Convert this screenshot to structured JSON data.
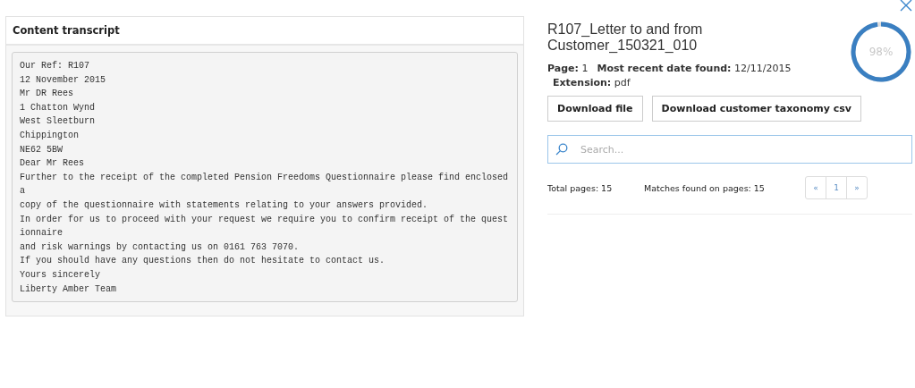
{
  "transcript": {
    "title": "Content transcript",
    "lines": [
      "Our Ref: R107",
      "12 November 2015",
      "Mr DR Rees",
      "1 Chatton Wynd",
      "West Sleetburn",
      "Chippington",
      "NE62 5BW",
      "Dear Mr Rees",
      "Further to the receipt of the completed Pension Freedoms Questionnaire please find enclosed",
      "a",
      "copy of the questionnaire with statements relating to your answers provided.",
      "In order for us to proceed with your request we require you to confirm receipt of the quest",
      "ionnaire",
      "and risk warnings by contacting us on 0161 763 7070.",
      "If you should have any questions then do not hesitate to contact us.",
      "Yours sincerely",
      "Liberty Amber Team"
    ]
  },
  "document": {
    "title": "R107_Letter to and from Customer_150321_010",
    "meta": [
      {
        "label": "Page:",
        "value": "1"
      },
      {
        "label": "Most recent date found:",
        "value": "12/11/2015"
      }
    ],
    "extension": {
      "label": "Extension:",
      "value": "pdf"
    },
    "gauge": {
      "reading": "98%"
    },
    "buttons": [
      "Download file",
      "Download customer taxonomy csv"
    ],
    "search": {
      "placeholder": "Search..."
    },
    "total_pages": "Total pages: 15",
    "matches": "Matches found on pages: 15",
    "pagination": [
      "«",
      "1",
      "»"
    ]
  }
}
